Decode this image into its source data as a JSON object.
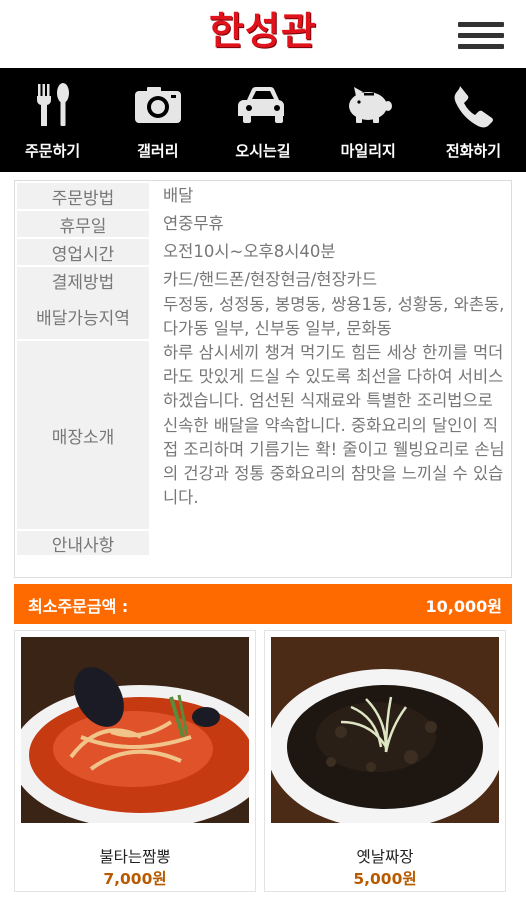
{
  "header": {
    "logo_text": "한성관",
    "menu_icon": "hamburger-menu-icon",
    "brand_color": "#e0121b"
  },
  "nav": {
    "items": [
      {
        "label": "주문하기",
        "icon": "fork-spoon-icon"
      },
      {
        "label": "갤러리",
        "icon": "camera-icon"
      },
      {
        "label": "오시는길",
        "icon": "car-icon"
      },
      {
        "label": "마일리지",
        "icon": "piggy-bank-icon"
      },
      {
        "label": "전화하기",
        "icon": "phone-icon"
      }
    ]
  },
  "info": {
    "rows": [
      {
        "label": "주문방법",
        "value": "배달"
      },
      {
        "label": "휴무일",
        "value": "연중무휴"
      },
      {
        "label": "영업시간",
        "value": "오전10시~오후8시40분"
      },
      {
        "label": "결제방법",
        "value": "카드/핸드폰/현장현금/현장카드"
      },
      {
        "label": "배달가능지역",
        "value": "두정동, 성정동, 봉명동, 쌍용1동, 성황동, 와촌동, 다가동 일부, 신부동 일부, 문화동"
      },
      {
        "label": "매장소개",
        "value": "하루 삼시세끼 챙겨 먹기도 힘든 세상 한끼를 먹더라도 맛있게 드실 수 있도록 최선을 다하여 서비스 하겠습니다. 엄선된 식재료와 특별한 조리법으로 신속한 배달을 약속합니다. 중화요리의 달인이 직접 조리하며 기름기는 확! 줄이고 웰빙요리로 손님의 건강과 정통 중화요리의 참맛을 느끼실 수 있습니다."
      },
      {
        "label": "안내사항",
        "value": ""
      }
    ]
  },
  "min_order": {
    "label": "최소주문금액 :",
    "amount": "10,000원",
    "color": "#ff6a00"
  },
  "menu_items": [
    {
      "name": "불타는짬뽕",
      "price": "7,000원"
    },
    {
      "name": "옛날짜장",
      "price": "5,000원"
    }
  ]
}
